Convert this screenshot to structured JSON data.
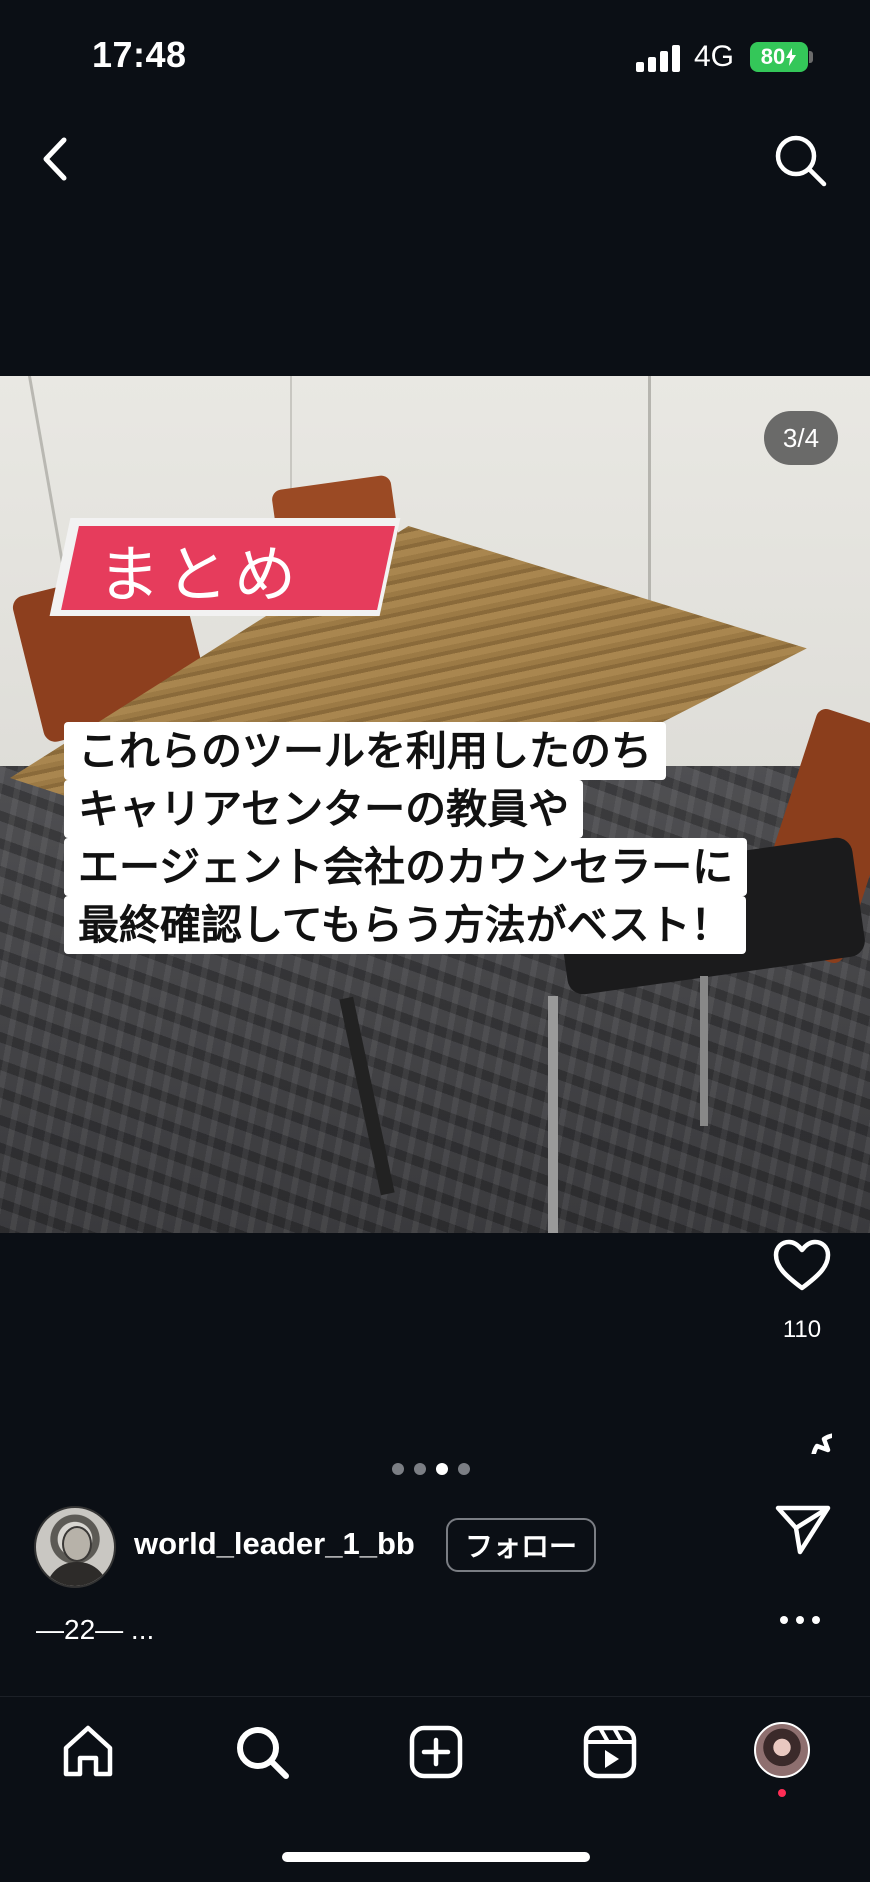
{
  "status_bar": {
    "time": "17:48",
    "network": "4G",
    "battery": "80",
    "battery_color": "#34c759"
  },
  "top_nav": {
    "back_icon": "chevron-left-icon",
    "search_icon": "search-icon"
  },
  "post": {
    "image_counter": "3/4",
    "tag_text": "まとめ",
    "tag_color": "#e63c5c",
    "caption_lines": [
      "これらのツールを利用したのち",
      "キャリアセンターの教員や",
      "エージェント会社のカウンセラーに",
      "最終確認してもらう方法がベスト！"
    ],
    "carousel_total": 4,
    "carousel_active": 3
  },
  "actions": {
    "like_icon": "heart-icon",
    "like_count": "110",
    "comment_icon": "comment-icon",
    "share_icon": "send-icon",
    "more_icon": "more-icon"
  },
  "author": {
    "username": "world_leader_1_bb",
    "follow_label": "フォロー"
  },
  "caption": {
    "text": "—22— ..."
  },
  "bottom_nav": {
    "items": [
      {
        "name": "home",
        "icon": "home-icon"
      },
      {
        "name": "search",
        "icon": "search-icon"
      },
      {
        "name": "create",
        "icon": "plus-square-icon"
      },
      {
        "name": "reels",
        "icon": "reels-icon"
      },
      {
        "name": "profile",
        "icon": "profile-avatar"
      }
    ],
    "notification_color": "#ff2d55"
  }
}
